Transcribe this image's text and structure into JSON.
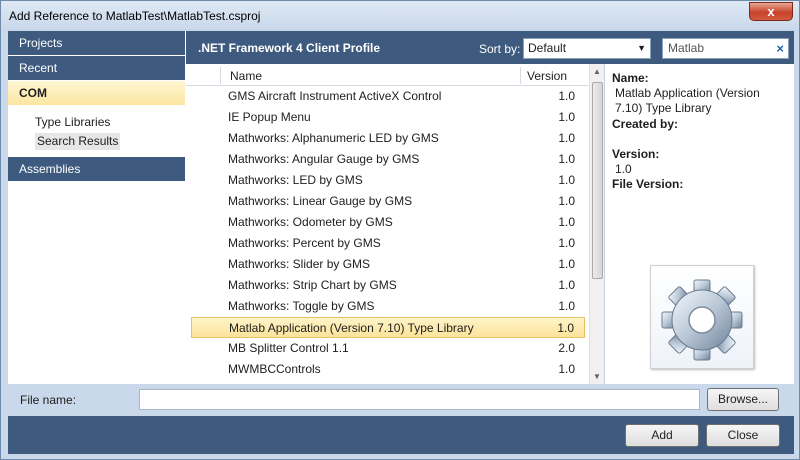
{
  "window": {
    "title": "Add Reference to MatlabTest\\MatlabTest.csproj",
    "close_label": "x"
  },
  "nav": {
    "projects": "Projects",
    "recent": "Recent",
    "com": "COM",
    "com_children": [
      "Type Libraries",
      "Search Results"
    ],
    "assemblies": "Assemblies"
  },
  "header": {
    "title": ".NET Framework 4 Client Profile",
    "sort_label": "Sort by:",
    "sort_value": "Default",
    "search_value": "Matlab",
    "search_clear": "×"
  },
  "list": {
    "col_name": "Name",
    "col_version": "Version",
    "rows": [
      {
        "name": "GMS Aircraft Instrument ActiveX Control",
        "version": "1.0"
      },
      {
        "name": "IE Popup Menu",
        "version": "1.0"
      },
      {
        "name": "Mathworks: Alphanumeric LED by GMS",
        "version": "1.0"
      },
      {
        "name": "Mathworks: Angular Gauge by GMS",
        "version": "1.0"
      },
      {
        "name": "Mathworks: LED by GMS",
        "version": "1.0"
      },
      {
        "name": "Mathworks: Linear Gauge by GMS",
        "version": "1.0"
      },
      {
        "name": "Mathworks: Odometer by GMS",
        "version": "1.0"
      },
      {
        "name": "Mathworks: Percent by GMS",
        "version": "1.0"
      },
      {
        "name": "Mathworks: Slider by GMS",
        "version": "1.0"
      },
      {
        "name": "Mathworks: Strip Chart by GMS",
        "version": "1.0"
      },
      {
        "name": "Mathworks: Toggle by GMS",
        "version": "1.0"
      },
      {
        "name": "Matlab Application (Version 7.10) Type Library",
        "version": "1.0"
      },
      {
        "name": "MB Splitter Control 1.1",
        "version": "2.0"
      },
      {
        "name": "MWMBCControls",
        "version": "1.0"
      }
    ]
  },
  "detail": {
    "name_label": "Name:",
    "name_value": "Matlab Application (Version 7.10) Type Library",
    "created_label": "Created by:",
    "created_value": "",
    "version_label": "Version:",
    "version_value": "1.0",
    "file_version_label": "File Version:",
    "file_version_value": "",
    "icon": "gear-icon"
  },
  "bottom": {
    "file_label": "File name:",
    "file_value": "",
    "browse": "Browse...",
    "add": "Add",
    "close": "Close"
  }
}
